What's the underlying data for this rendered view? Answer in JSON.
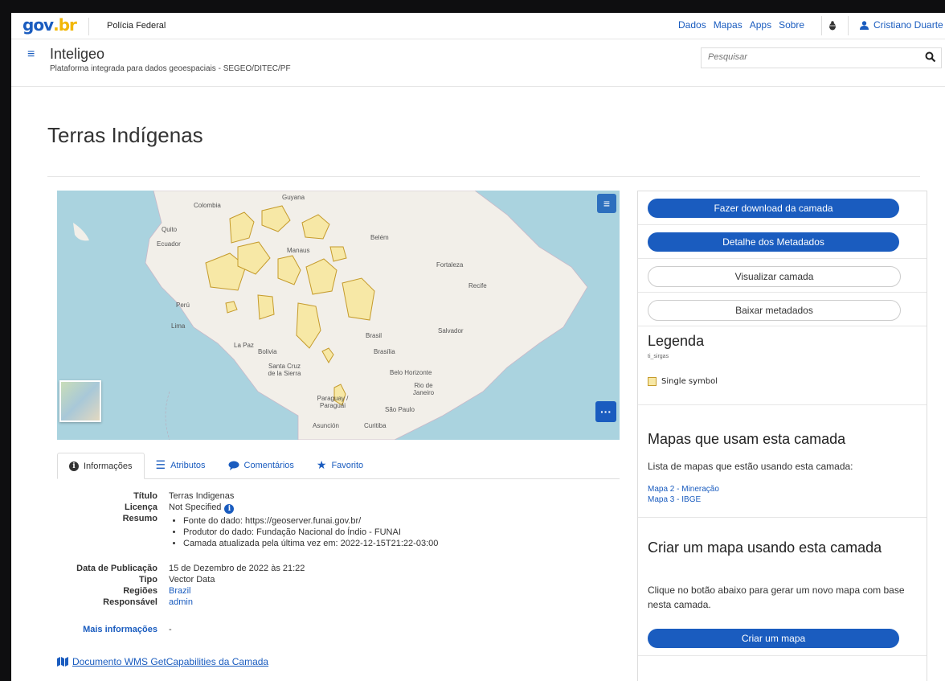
{
  "topbar": {
    "logo_main": "gov",
    "logo_accent": ".br",
    "org": "Polícia Federal",
    "links": [
      "Dados",
      "Mapas",
      "Apps",
      "Sobre"
    ],
    "user_name": "Cristiano Duarte"
  },
  "appbar": {
    "name": "Inteligeo",
    "subtitle": "Plataforma integrada para dados geoespaciais - SEGEO/DITEC/PF",
    "search_placeholder": "Pesquisar"
  },
  "page": {
    "title": "Terras Indígenas"
  },
  "map": {
    "labels": [
      "Colombia",
      "Guyana",
      "Quito",
      "Ecuador",
      "Belém",
      "Manaus",
      "Fortaleza",
      "Recife",
      "Perú",
      "Lima",
      "Brasil",
      "Salvador",
      "La Paz",
      "Bolivia",
      "Brasília",
      "Santa Cruz de la Sierra",
      "Belo Horizonte",
      "Rio de Janeiro",
      "Paraguay / Paraguái",
      "São Paulo",
      "Asunción",
      "Curitiba"
    ]
  },
  "tabs": [
    {
      "label": "Informações",
      "icon": "info-icon"
    },
    {
      "label": "Atributos",
      "icon": "list-icon"
    },
    {
      "label": "Comentários",
      "icon": "comment-icon"
    },
    {
      "label": "Favorito",
      "icon": "star-icon"
    }
  ],
  "info": {
    "titulo_label": "Título",
    "titulo": "Terras Indigenas",
    "licenca_label": "Licença",
    "licenca": "Not Specified",
    "resumo_label": "Resumo",
    "resumo": [
      "Fonte do dado: https://geoserver.funai.gov.br/",
      "Produtor do dado: Fundação Nacional do Índio - FUNAI",
      "Camada atualizada pela última vez em: 2022-12-15T21:22-03:00"
    ],
    "data_label": "Data de Publicação",
    "data": "15 de Dezembro de 2022 às 21:22",
    "tipo_label": "Tipo",
    "tipo": "Vector Data",
    "regioes_label": "Regiões",
    "regioes": "Brazil",
    "responsavel_label": "Responsável",
    "responsavel": "admin",
    "mais_label": "Mais informações",
    "mais": "-",
    "wms_link": "Documento WMS GetCapabilities da Camada"
  },
  "panel": {
    "btn_download": "Fazer download da camada",
    "btn_metadata": "Detalhe dos Metadados",
    "btn_view": "Visualizar camada",
    "btn_baixar": "Baixar metadados",
    "legenda_title": "Legenda",
    "legenda_layer": "ti_sirgas",
    "legenda_symbol": "Single symbol",
    "mapas_title": "Mapas que usam esta camada",
    "mapas_text": "Lista de mapas que estão usando esta camada:",
    "mapas_links": [
      "Mapa 2 - Mineração",
      "Mapa 3 - IBGE"
    ],
    "criar_title": "Criar um mapa usando esta camada",
    "criar_text": "Clique no botão abaixo para gerar um novo mapa com base nesta camada.",
    "btn_criar": "Criar um mapa"
  },
  "colors": {
    "brand_blue": "#1a5cbf",
    "gov_yellow": "#f2b705",
    "map_water": "#aad3df",
    "map_land": "#f2efe9",
    "territory_fill": "#f7e8a6",
    "territory_stroke": "#c59b2c"
  }
}
